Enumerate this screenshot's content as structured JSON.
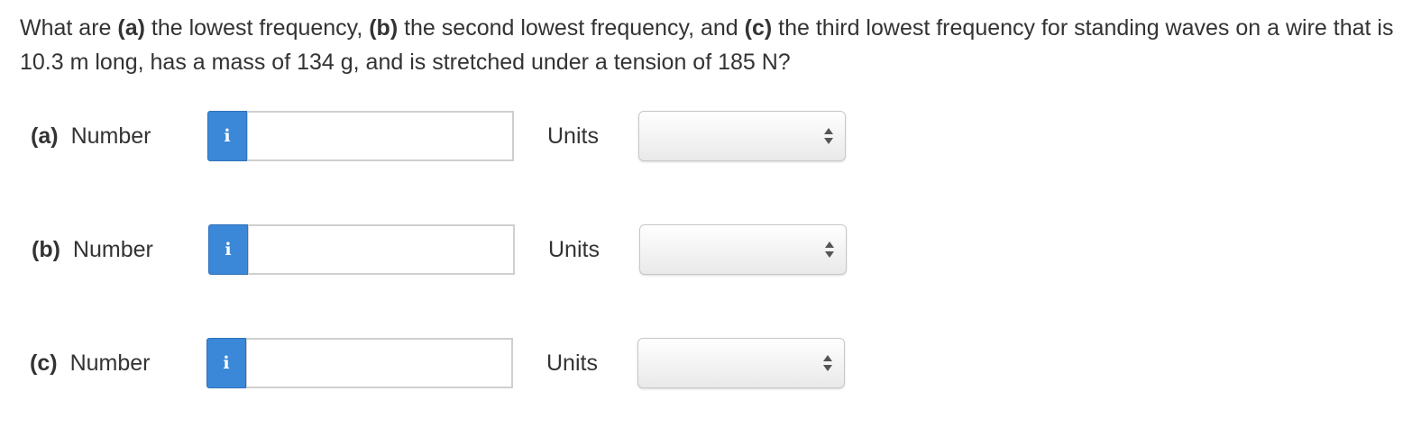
{
  "question": {
    "part1": "What are ",
    "a_tag": "(a)",
    "part2": " the lowest frequency, ",
    "b_tag": "(b)",
    "part3": " the second lowest frequency, and ",
    "c_tag": "(c)",
    "part4": " the third lowest frequency for standing waves on a wire that is 10.3 m long, has a mass of 134 g, and is stretched under a tension of 185 N?"
  },
  "rows": [
    {
      "letter": "(a)",
      "number_label": "Number",
      "info_icon": "i",
      "number_value": "",
      "units_label": "Units",
      "units_value": ""
    },
    {
      "letter": "(b)",
      "number_label": "Number",
      "info_icon": "i",
      "number_value": "",
      "units_label": "Units",
      "units_value": ""
    },
    {
      "letter": "(c)",
      "number_label": "Number",
      "info_icon": "i",
      "number_value": "",
      "units_label": "Units",
      "units_value": ""
    }
  ],
  "icons": {
    "info": "info-icon",
    "select_arrows": "up-down-arrows-icon"
  },
  "colors": {
    "info_button": "#3b87d8",
    "text": "#333333",
    "input_border": "#cfcfcf"
  }
}
